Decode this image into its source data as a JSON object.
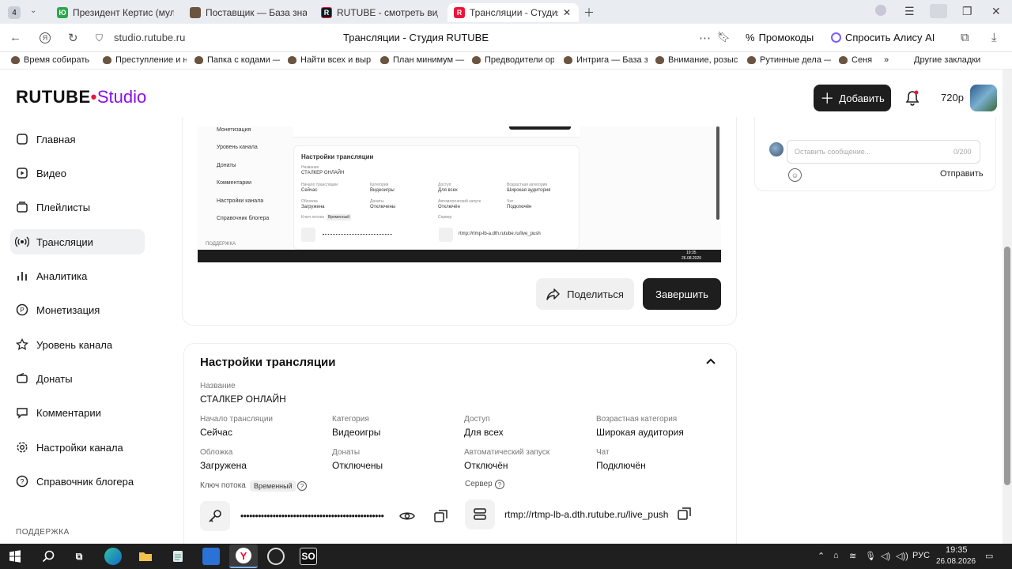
{
  "browser": {
    "tab_count": "4",
    "tabs": [
      {
        "label": "Президент Кертис (мульт"
      },
      {
        "label": "Поставщик — База знани"
      },
      {
        "label": "RUTUBE - смотреть виде"
      },
      {
        "label": "Трансляции - Студия R"
      }
    ],
    "url": "studio.rutube.ru",
    "page_title": "Трансляции - Студия RUTUBE",
    "promo_label": "Промокоды",
    "alice_label": "Спросить Алису AI",
    "bookmarks": [
      "Время собирать",
      "Преступление и н",
      "Папка с кодами —",
      "Найти всех и выр",
      "План минимум —",
      "Предводители ор",
      "Интрига — База з",
      "Внимание, розыс",
      "Рутинные дела —",
      "Сеня"
    ],
    "other_bookmarks": "Другие закладки"
  },
  "header": {
    "logo_brand": "RUTUBE",
    "logo_studio": "Studio",
    "add_label": "Добавить",
    "quality": "720p"
  },
  "sidebar": {
    "items": [
      {
        "label": "Главная"
      },
      {
        "label": "Видео"
      },
      {
        "label": "Плейлисты"
      },
      {
        "label": "Трансляции"
      },
      {
        "label": "Аналитика"
      },
      {
        "label": "Монетизация"
      },
      {
        "label": "Уровень канала"
      },
      {
        "label": "Донаты"
      },
      {
        "label": "Комментарии"
      },
      {
        "label": "Настройки канала"
      },
      {
        "label": "Справочник блогера"
      }
    ],
    "support": "ПОДДЕРЖКА"
  },
  "preview": {
    "side_items": [
      "Монетизация",
      "Уровень канала",
      "Донаты",
      "Комментарии",
      "Настройки канала",
      "Справочник блогера",
      "ПОДДЕРЖКА"
    ],
    "title": "Настройки трансляции",
    "name_label": "Название",
    "name_value": "СТАЛКЕР ОНЛАЙН",
    "labels": [
      "Начало трансляции",
      "Категория",
      "Доступ",
      "Возрастная категория",
      "Обложка",
      "Донаты",
      "Автоматический запуск",
      "Чат"
    ],
    "values": [
      "Сейчас",
      "Видеоигры",
      "Для всех",
      "Широкая аудитория",
      "Загружена",
      "Отключены",
      "Отключён",
      "Подключён"
    ],
    "key_label": "Ключ потока",
    "badge": "Временный",
    "server_label": "Сервер",
    "server": "rtmp://rtmp-lb-a.dth.rutube.ru/live_push",
    "tray_time": "19:35",
    "tray_date": "26.08.2026"
  },
  "actions": {
    "share": "Поделиться",
    "finish": "Завершить"
  },
  "settings": {
    "title": "Настройки трансляции",
    "name_label": "Название",
    "name_value": "СТАЛКЕР ОНЛАЙН",
    "start_label": "Начало трансляции",
    "start_value": "Сейчас",
    "category_label": "Категория",
    "category_value": "Видеоигры",
    "access_label": "Доступ",
    "access_value": "Для всех",
    "age_label": "Возрастная категория",
    "age_value": "Широкая аудитория",
    "cover_label": "Обложка",
    "cover_value": "Загружена",
    "donate_label": "Донаты",
    "donate_value": "Отключены",
    "autostart_label": "Автоматический запуск",
    "autostart_value": "Отключён",
    "chat_label": "Чат",
    "chat_value": "Подключён",
    "key_label": "Ключ потока",
    "key_badge": "Временный",
    "key_masked": "••••••••••••••••••••••••••••••••••••••••••••••••••••••••••",
    "server_label": "Сервер",
    "server_value": "rtmp://rtmp-lb-a.dth.rutube.ru/live_push"
  },
  "chat": {
    "placeholder": "Оставить сообщение...",
    "counter": "0/200",
    "send": "Отправить"
  },
  "taskbar": {
    "lang": "РУС",
    "time": "19:35",
    "date": "26.08.2026",
    "obs_label": "SO"
  },
  "colors": {
    "accent": "#8a0fe8",
    "brand_red": "#ed143b",
    "dark_button": "#1e1e1e"
  }
}
